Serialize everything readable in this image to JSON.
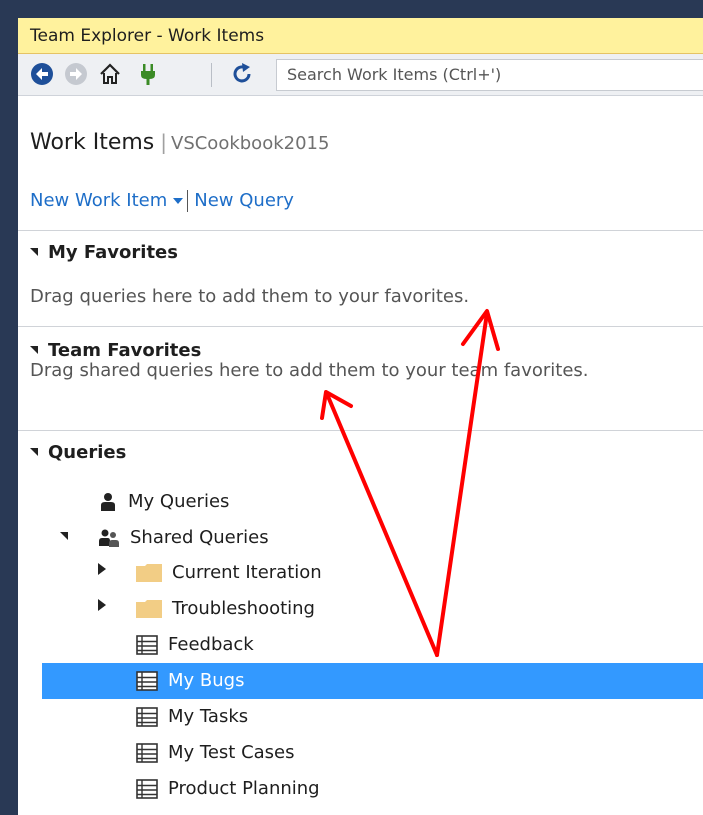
{
  "window": {
    "title": "Team Explorer - Work Items"
  },
  "toolbar": {
    "search_placeholder": "Search Work Items (Ctrl+')",
    "icons": [
      "back-icon",
      "forward-icon",
      "home-icon",
      "connect-icon",
      "refresh-icon"
    ]
  },
  "header": {
    "title": "Work Items",
    "separator": "|",
    "project": "VSCookbook2015"
  },
  "actions": {
    "new_work_item": "New Work Item",
    "new_query": "New Query"
  },
  "sections": {
    "my_favorites": {
      "title": "My Favorites",
      "hint": "Drag queries here to add them to your favorites."
    },
    "team_favorites": {
      "title": "Team Favorites",
      "hint": "Drag shared queries here to add them to your team favorites."
    },
    "queries": {
      "title": "Queries",
      "my_queries": "My Queries",
      "shared_queries": "Shared Queries",
      "folders": [
        "Current Iteration",
        "Troubleshooting"
      ],
      "items": [
        "Feedback",
        "My Bugs",
        "My Tasks",
        "My Test Cases",
        "Product Planning"
      ],
      "selected": "My Bugs"
    }
  },
  "colors": {
    "title_bar": "#fff29d",
    "frame": "#293955",
    "link": "#1e6ec8",
    "selection": "#3399ff",
    "annotation_arrow": "#ff0000"
  }
}
